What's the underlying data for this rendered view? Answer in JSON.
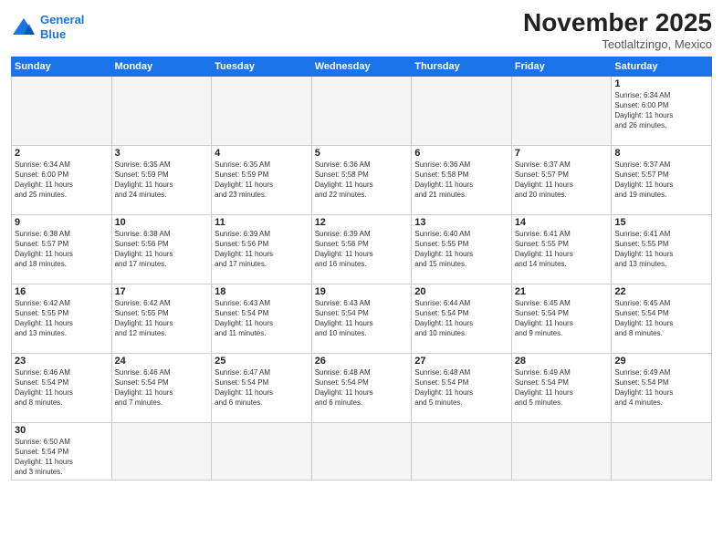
{
  "header": {
    "logo_general": "General",
    "logo_blue": "Blue",
    "month_title": "November 2025",
    "location": "Teotlaltzingo, Mexico"
  },
  "weekdays": [
    "Sunday",
    "Monday",
    "Tuesday",
    "Wednesday",
    "Thursday",
    "Friday",
    "Saturday"
  ],
  "weeks": [
    [
      {
        "day": "",
        "info": ""
      },
      {
        "day": "",
        "info": ""
      },
      {
        "day": "",
        "info": ""
      },
      {
        "day": "",
        "info": ""
      },
      {
        "day": "",
        "info": ""
      },
      {
        "day": "",
        "info": ""
      },
      {
        "day": "1",
        "info": "Sunrise: 6:34 AM\nSunset: 6:00 PM\nDaylight: 11 hours\nand 26 minutes."
      }
    ],
    [
      {
        "day": "2",
        "info": "Sunrise: 6:34 AM\nSunset: 6:00 PM\nDaylight: 11 hours\nand 25 minutes."
      },
      {
        "day": "3",
        "info": "Sunrise: 6:35 AM\nSunset: 5:59 PM\nDaylight: 11 hours\nand 24 minutes."
      },
      {
        "day": "4",
        "info": "Sunrise: 6:35 AM\nSunset: 5:59 PM\nDaylight: 11 hours\nand 23 minutes."
      },
      {
        "day": "5",
        "info": "Sunrise: 6:36 AM\nSunset: 5:58 PM\nDaylight: 11 hours\nand 22 minutes."
      },
      {
        "day": "6",
        "info": "Sunrise: 6:36 AM\nSunset: 5:58 PM\nDaylight: 11 hours\nand 21 minutes."
      },
      {
        "day": "7",
        "info": "Sunrise: 6:37 AM\nSunset: 5:57 PM\nDaylight: 11 hours\nand 20 minutes."
      },
      {
        "day": "8",
        "info": "Sunrise: 6:37 AM\nSunset: 5:57 PM\nDaylight: 11 hours\nand 19 minutes."
      }
    ],
    [
      {
        "day": "9",
        "info": "Sunrise: 6:38 AM\nSunset: 5:57 PM\nDaylight: 11 hours\nand 18 minutes."
      },
      {
        "day": "10",
        "info": "Sunrise: 6:38 AM\nSunset: 5:56 PM\nDaylight: 11 hours\nand 17 minutes."
      },
      {
        "day": "11",
        "info": "Sunrise: 6:39 AM\nSunset: 5:56 PM\nDaylight: 11 hours\nand 17 minutes."
      },
      {
        "day": "12",
        "info": "Sunrise: 6:39 AM\nSunset: 5:56 PM\nDaylight: 11 hours\nand 16 minutes."
      },
      {
        "day": "13",
        "info": "Sunrise: 6:40 AM\nSunset: 5:55 PM\nDaylight: 11 hours\nand 15 minutes."
      },
      {
        "day": "14",
        "info": "Sunrise: 6:41 AM\nSunset: 5:55 PM\nDaylight: 11 hours\nand 14 minutes."
      },
      {
        "day": "15",
        "info": "Sunrise: 6:41 AM\nSunset: 5:55 PM\nDaylight: 11 hours\nand 13 minutes."
      }
    ],
    [
      {
        "day": "16",
        "info": "Sunrise: 6:42 AM\nSunset: 5:55 PM\nDaylight: 11 hours\nand 13 minutes."
      },
      {
        "day": "17",
        "info": "Sunrise: 6:42 AM\nSunset: 5:55 PM\nDaylight: 11 hours\nand 12 minutes."
      },
      {
        "day": "18",
        "info": "Sunrise: 6:43 AM\nSunset: 5:54 PM\nDaylight: 11 hours\nand 11 minutes."
      },
      {
        "day": "19",
        "info": "Sunrise: 6:43 AM\nSunset: 5:54 PM\nDaylight: 11 hours\nand 10 minutes."
      },
      {
        "day": "20",
        "info": "Sunrise: 6:44 AM\nSunset: 5:54 PM\nDaylight: 11 hours\nand 10 minutes."
      },
      {
        "day": "21",
        "info": "Sunrise: 6:45 AM\nSunset: 5:54 PM\nDaylight: 11 hours\nand 9 minutes."
      },
      {
        "day": "22",
        "info": "Sunrise: 6:45 AM\nSunset: 5:54 PM\nDaylight: 11 hours\nand 8 minutes."
      }
    ],
    [
      {
        "day": "23",
        "info": "Sunrise: 6:46 AM\nSunset: 5:54 PM\nDaylight: 11 hours\nand 8 minutes."
      },
      {
        "day": "24",
        "info": "Sunrise: 6:46 AM\nSunset: 5:54 PM\nDaylight: 11 hours\nand 7 minutes."
      },
      {
        "day": "25",
        "info": "Sunrise: 6:47 AM\nSunset: 5:54 PM\nDaylight: 11 hours\nand 6 minutes."
      },
      {
        "day": "26",
        "info": "Sunrise: 6:48 AM\nSunset: 5:54 PM\nDaylight: 11 hours\nand 6 minutes."
      },
      {
        "day": "27",
        "info": "Sunrise: 6:48 AM\nSunset: 5:54 PM\nDaylight: 11 hours\nand 5 minutes."
      },
      {
        "day": "28",
        "info": "Sunrise: 6:49 AM\nSunset: 5:54 PM\nDaylight: 11 hours\nand 5 minutes."
      },
      {
        "day": "29",
        "info": "Sunrise: 6:49 AM\nSunset: 5:54 PM\nDaylight: 11 hours\nand 4 minutes."
      }
    ],
    [
      {
        "day": "30",
        "info": "Sunrise: 6:50 AM\nSunset: 5:54 PM\nDaylight: 11 hours\nand 3 minutes."
      },
      {
        "day": "",
        "info": ""
      },
      {
        "day": "",
        "info": ""
      },
      {
        "day": "",
        "info": ""
      },
      {
        "day": "",
        "info": ""
      },
      {
        "day": "",
        "info": ""
      },
      {
        "day": "",
        "info": ""
      }
    ]
  ]
}
